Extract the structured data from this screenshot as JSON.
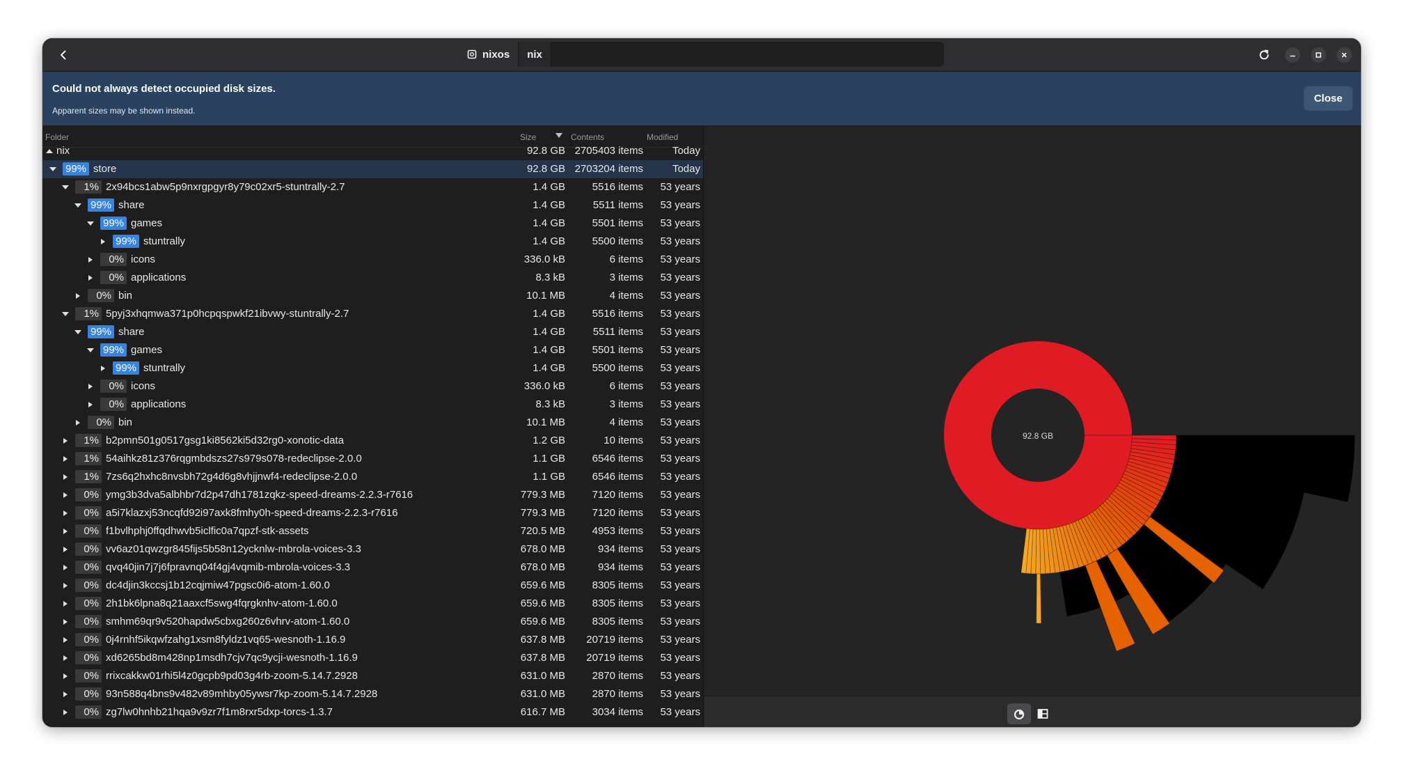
{
  "header": {
    "crumbs": [
      {
        "label": "nixos",
        "icon": "drive-icon"
      },
      {
        "label": "nix",
        "icon": ""
      }
    ]
  },
  "infobar": {
    "title": "Could not always detect occupied disk sizes.",
    "subtitle": "Apparent sizes may be shown instead.",
    "close_label": "Close"
  },
  "columns": {
    "folder": "Folder",
    "size": "Size",
    "contents": "Contents",
    "modified": "Modified"
  },
  "rows": [
    {
      "depth": -1,
      "expander": "up",
      "pct": "",
      "name": "nix",
      "size": "92.8 GB",
      "contents": "2705403 items",
      "modified": "Today"
    },
    {
      "depth": 0,
      "expander": "down",
      "pct": "99%",
      "name": "store",
      "size": "92.8 GB",
      "contents": "2703204 items",
      "modified": "Today",
      "selected": true,
      "hi": true
    },
    {
      "depth": 1,
      "expander": "down",
      "pct": "1%",
      "name": "2x94bcs1abw5p9nxrgpgyr8y79c02xr5-stuntrally-2.7",
      "size": "1.4 GB",
      "contents": "5516 items",
      "modified": "53 years"
    },
    {
      "depth": 2,
      "expander": "down",
      "pct": "99%",
      "name": "share",
      "size": "1.4 GB",
      "contents": "5511 items",
      "modified": "53 years",
      "hi": true
    },
    {
      "depth": 3,
      "expander": "down",
      "pct": "99%",
      "name": "games",
      "size": "1.4 GB",
      "contents": "5501 items",
      "modified": "53 years",
      "hi": true
    },
    {
      "depth": 4,
      "expander": "right",
      "pct": "99%",
      "name": "stuntrally",
      "size": "1.4 GB",
      "contents": "5500 items",
      "modified": "53 years",
      "hi": true
    },
    {
      "depth": 3,
      "expander": "right",
      "pct": "0%",
      "name": "icons",
      "size": "336.0 kB",
      "contents": "6 items",
      "modified": "53 years"
    },
    {
      "depth": 3,
      "expander": "right",
      "pct": "0%",
      "name": "applications",
      "size": "8.3 kB",
      "contents": "3 items",
      "modified": "53 years"
    },
    {
      "depth": 2,
      "expander": "right",
      "pct": "0%",
      "name": "bin",
      "size": "10.1 MB",
      "contents": "4 items",
      "modified": "53 years"
    },
    {
      "depth": 1,
      "expander": "down",
      "pct": "1%",
      "name": "5pyj3xhqmwa371p0hcpqspwkf21ibvwy-stuntrally-2.7",
      "size": "1.4 GB",
      "contents": "5516 items",
      "modified": "53 years"
    },
    {
      "depth": 2,
      "expander": "down",
      "pct": "99%",
      "name": "share",
      "size": "1.4 GB",
      "contents": "5511 items",
      "modified": "53 years",
      "hi": true
    },
    {
      "depth": 3,
      "expander": "down",
      "pct": "99%",
      "name": "games",
      "size": "1.4 GB",
      "contents": "5501 items",
      "modified": "53 years",
      "hi": true
    },
    {
      "depth": 4,
      "expander": "right",
      "pct": "99%",
      "name": "stuntrally",
      "size": "1.4 GB",
      "contents": "5500 items",
      "modified": "53 years",
      "hi": true
    },
    {
      "depth": 3,
      "expander": "right",
      "pct": "0%",
      "name": "icons",
      "size": "336.0 kB",
      "contents": "6 items",
      "modified": "53 years"
    },
    {
      "depth": 3,
      "expander": "right",
      "pct": "0%",
      "name": "applications",
      "size": "8.3 kB",
      "contents": "3 items",
      "modified": "53 years"
    },
    {
      "depth": 2,
      "expander": "right",
      "pct": "0%",
      "name": "bin",
      "size": "10.1 MB",
      "contents": "4 items",
      "modified": "53 years"
    },
    {
      "depth": 1,
      "expander": "right",
      "pct": "1%",
      "name": "b2pmn501g0517gsg1ki8562ki5d32rg0-xonotic-data",
      "size": "1.2 GB",
      "contents": "10 items",
      "modified": "53 years"
    },
    {
      "depth": 1,
      "expander": "right",
      "pct": "1%",
      "name": "54aihkz81z376rqgmbdszs27s979s078-redeclipse-2.0.0",
      "size": "1.1 GB",
      "contents": "6546 items",
      "modified": "53 years"
    },
    {
      "depth": 1,
      "expander": "right",
      "pct": "1%",
      "name": "7zs6q2hxhc8nvsbh72g4d6g8vhjjnwf4-redeclipse-2.0.0",
      "size": "1.1 GB",
      "contents": "6546 items",
      "modified": "53 years"
    },
    {
      "depth": 1,
      "expander": "right",
      "pct": "0%",
      "name": "ymg3b3dva5albhbr7d2p47dh1781zqkz-speed-dreams-2.2.3-r7616",
      "size": "779.3 MB",
      "contents": "7120 items",
      "modified": "53 years"
    },
    {
      "depth": 1,
      "expander": "right",
      "pct": "0%",
      "name": "a5i7klazxj53ncqfd92i97axk8fmhy0h-speed-dreams-2.2.3-r7616",
      "size": "779.3 MB",
      "contents": "7120 items",
      "modified": "53 years"
    },
    {
      "depth": 1,
      "expander": "right",
      "pct": "0%",
      "name": "f1bvlhphj0ffqdhwvb5iclfic0a7qpzf-stk-assets",
      "size": "720.5 MB",
      "contents": "4953 items",
      "modified": "53 years"
    },
    {
      "depth": 1,
      "expander": "right",
      "pct": "0%",
      "name": "vv6az01qwzgr845fijs5b58n12ycknlw-mbrola-voices-3.3",
      "size": "678.0 MB",
      "contents": "934 items",
      "modified": "53 years"
    },
    {
      "depth": 1,
      "expander": "right",
      "pct": "0%",
      "name": "qvq40jin7j7j6fpravnq04f4gj4vqmib-mbrola-voices-3.3",
      "size": "678.0 MB",
      "contents": "934 items",
      "modified": "53 years"
    },
    {
      "depth": 1,
      "expander": "right",
      "pct": "0%",
      "name": "dc4djin3kccsj1b12cqjmiw47pgsc0i6-atom-1.60.0",
      "size": "659.6 MB",
      "contents": "8305 items",
      "modified": "53 years"
    },
    {
      "depth": 1,
      "expander": "right",
      "pct": "0%",
      "name": "2h1bk6lpna8q21aaxcf5swg4fqrgknhv-atom-1.60.0",
      "size": "659.6 MB",
      "contents": "8305 items",
      "modified": "53 years"
    },
    {
      "depth": 1,
      "expander": "right",
      "pct": "0%",
      "name": "smhm69qr9v520hapdw5cbxg260z6vhrv-atom-1.60.0",
      "size": "659.6 MB",
      "contents": "8305 items",
      "modified": "53 years"
    },
    {
      "depth": 1,
      "expander": "right",
      "pct": "0%",
      "name": "0j4rnhf5ikqwfzahg1xsm8fyldz1vq65-wesnoth-1.16.9",
      "size": "637.8 MB",
      "contents": "20719 items",
      "modified": "53 years"
    },
    {
      "depth": 1,
      "expander": "right",
      "pct": "0%",
      "name": "xd6265bd8m428np1msdh7cjv7qc9ycji-wesnoth-1.16.9",
      "size": "637.8 MB",
      "contents": "20719 items",
      "modified": "53 years"
    },
    {
      "depth": 1,
      "expander": "right",
      "pct": "0%",
      "name": "rrixcakkw01rhi5l4z0gcpb9pd03g4rb-zoom-5.14.7.2928",
      "size": "631.0 MB",
      "contents": "2870 items",
      "modified": "53 years"
    },
    {
      "depth": 1,
      "expander": "right",
      "pct": "0%",
      "name": "93n588q4bns9v482v89mhby05ywsr7kp-zoom-5.14.7.2928",
      "size": "631.0 MB",
      "contents": "2870 items",
      "modified": "53 years"
    },
    {
      "depth": 1,
      "expander": "right",
      "pct": "0%",
      "name": "zg7lw0hnhb21hqa9v9zr7f1m8rxr5dxp-torcs-1.3.7",
      "size": "616.7 MB",
      "contents": "3034 items",
      "modified": "53 years"
    }
  ],
  "chart": {
    "center_label": "92.8 GB",
    "colors": {
      "red": "#e01b24",
      "dark_red": "#a51d2d",
      "orange": "#e66100",
      "amber": "#f5a623"
    }
  },
  "view_switch": {
    "ring_icon": "ring-chart-icon",
    "tree_icon": "treemap-chart-icon"
  }
}
